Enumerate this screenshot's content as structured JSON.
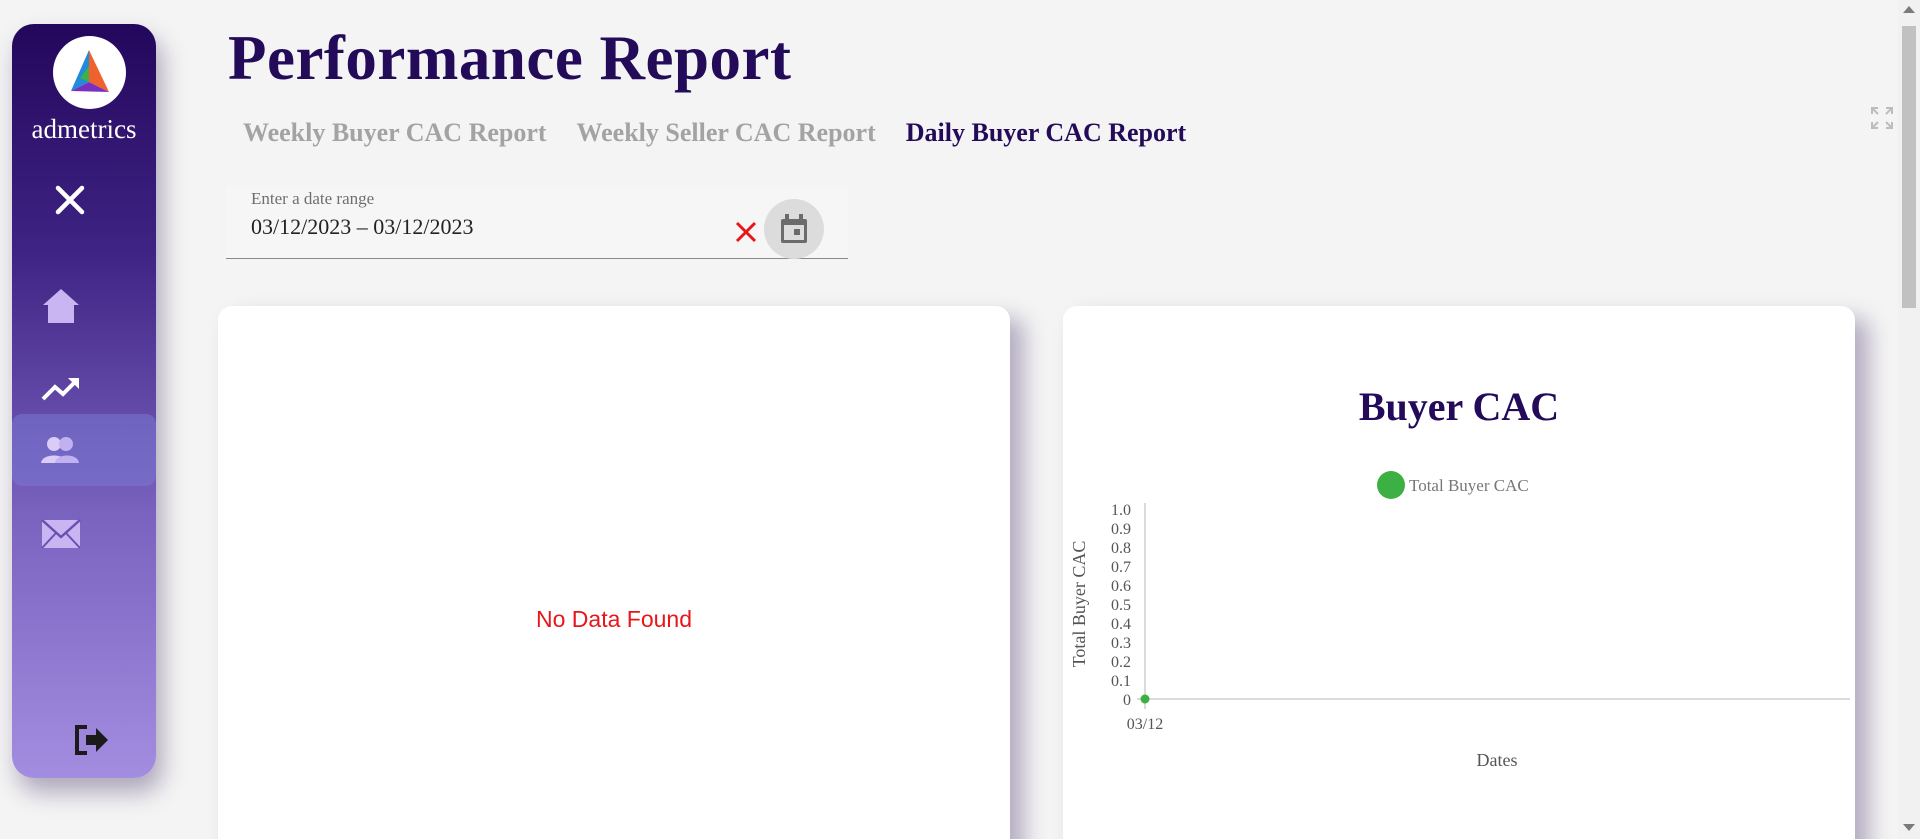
{
  "sidebar": {
    "brand": "admetrics",
    "items": [
      {
        "name": "home-icon"
      },
      {
        "name": "trending-up-icon"
      },
      {
        "name": "people-icon",
        "active": true
      },
      {
        "name": "mail-icon"
      }
    ],
    "close_icon": "close-icon",
    "logout_icon": "logout-icon"
  },
  "header": {
    "title": "Performance Report",
    "tabs": [
      {
        "label": "Weekly Buyer CAC Report",
        "active": false
      },
      {
        "label": "Weekly Seller CAC Report",
        "active": false
      },
      {
        "label": "Daily Buyer CAC Report",
        "active": true
      }
    ]
  },
  "date_range": {
    "label": "Enter a date range",
    "value": "03/12/2023 – 03/12/2023"
  },
  "left_card": {
    "message": "No Data Found"
  },
  "chart_data": {
    "type": "line",
    "title": "Buyer CAC",
    "xlabel": "Dates",
    "ylabel": "Total Buyer CAC",
    "categories": [
      "03/12"
    ],
    "series": [
      {
        "name": "Total Buyer CAC",
        "values": [
          0
        ],
        "color": "#3cb043"
      }
    ],
    "ylim": [
      0,
      1.0
    ],
    "yticks": [
      "0",
      "0.1",
      "0.2",
      "0.3",
      "0.4",
      "0.5",
      "0.6",
      "0.7",
      "0.8",
      "0.9",
      "1.0"
    ],
    "legend": "top-center",
    "grid": false
  },
  "colors": {
    "accent": "#230b5a",
    "inactive_tab": "#a3a3a3",
    "error": "#e8161a",
    "series": "#3cb043"
  }
}
